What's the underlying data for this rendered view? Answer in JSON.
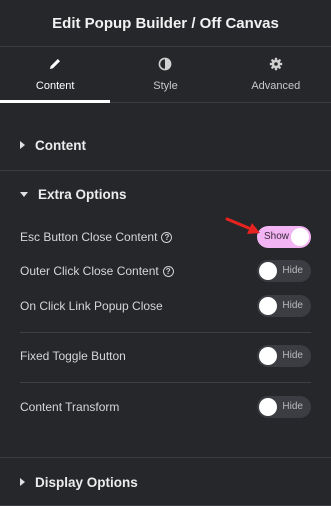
{
  "header": {
    "title": "Edit Popup Builder / Off Canvas"
  },
  "tabs": [
    {
      "label": "Content",
      "icon": "pencil-icon"
    },
    {
      "label": "Style",
      "icon": "half-circle-icon"
    },
    {
      "label": "Advanced",
      "icon": "gear-icon"
    }
  ],
  "sections": {
    "content": {
      "title": "Content"
    },
    "extra": {
      "title": "Extra Options",
      "rows": [
        {
          "label": "Esc Button Close Content",
          "help": "?",
          "state": "Show"
        },
        {
          "label": "Outer Click Close Content",
          "help": "?",
          "state": "Hide"
        },
        {
          "label": "On Click Link Popup Close",
          "state": "Hide"
        },
        {
          "label": "Fixed Toggle Button",
          "state": "Hide"
        },
        {
          "label": "Content Transform",
          "state": "Hide"
        }
      ]
    },
    "display": {
      "title": "Display Options"
    }
  },
  "colors": {
    "background": "#26272b",
    "toggle_on": "#f2b4f2",
    "arrow": "#e8231f"
  }
}
